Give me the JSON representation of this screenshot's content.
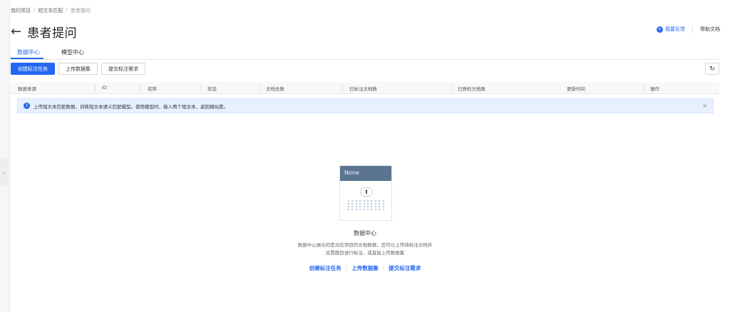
{
  "breadcrumb": [
    "我的项目",
    "短文本匹配",
    "患者提问"
  ],
  "breadcrumb_sep": "/",
  "page_title": "患者提问",
  "header": {
    "feedback_label": "我要反馈",
    "help_label": "帮助文档"
  },
  "tabs": [
    {
      "label": "数据中心",
      "active": true
    },
    {
      "label": "模型中心",
      "active": false
    }
  ],
  "toolbar": {
    "create_task": "创建标注任务",
    "upload_dataset": "上传数据集",
    "submit_request": "提交标注需求"
  },
  "table": {
    "columns": [
      "数据来源",
      "ID",
      "名称",
      "状态",
      "文档总数",
      "已标注文档数",
      "已质检文档数",
      "更新时间",
      "操作"
    ]
  },
  "alert": {
    "text": "上传短文本匹配数据，训练短文本语义匹配模型。使用模型时，输入两个短文本，返回相似度。",
    "close": "×"
  },
  "empty_state": {
    "illustration_header": "None",
    "title": "数据中心",
    "desc_line1": "数据中心展示的是对应项目的文档数据，您可以上传待标注文档并",
    "desc_line2": "设置题目进行标注，或直接上传数据集",
    "links": [
      "创建标注任务",
      "上传数据集",
      "提交标注需求"
    ]
  },
  "colors": {
    "primary": "#2468f2",
    "alert_bg": "#e6f0ff",
    "illustration_header": "#5b7491"
  },
  "icons": [
    "back-arrow-icon",
    "feedback-icon",
    "refresh-icon",
    "info-icon",
    "close-icon",
    "upload-cloud-icon",
    "collapse-chevron-icon"
  ]
}
